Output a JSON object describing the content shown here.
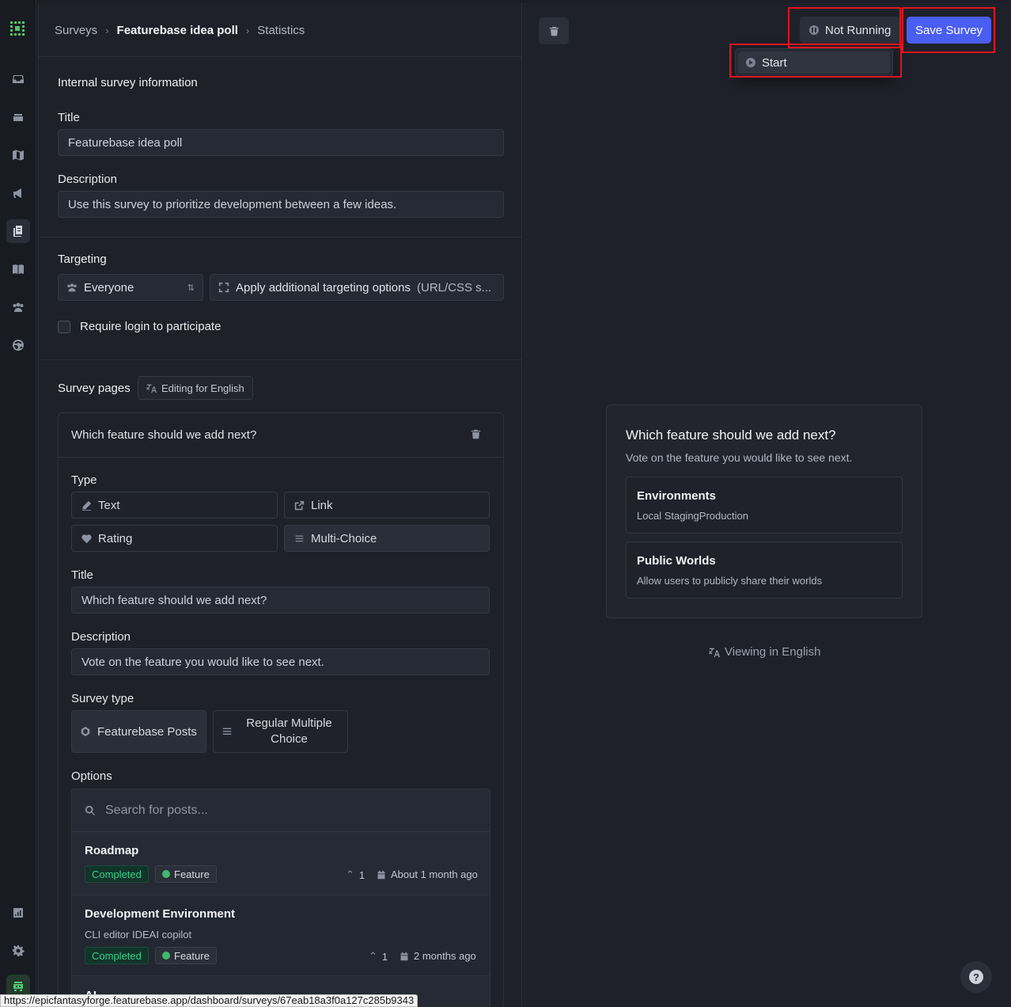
{
  "breadcrumb": {
    "root": "Surveys",
    "current": "Featurebase idea poll",
    "tab": "Statistics"
  },
  "internal": {
    "heading": "Internal survey information",
    "title_label": "Title",
    "title_value": "Featurebase idea poll",
    "description_label": "Description",
    "description_value": "Use this survey to prioritize development between a few ideas."
  },
  "targeting": {
    "heading": "Targeting",
    "audience": "Everyone",
    "additional": "Apply additional targeting options",
    "additional_hint": "(URL/CSS s...",
    "require_login": "Require login to participate"
  },
  "pages": {
    "heading": "Survey pages",
    "language_pill": "Editing for English",
    "page_title": "Which feature should we add next?",
    "type_label": "Type",
    "types": [
      "Text",
      "Link",
      "Rating",
      "Multi-Choice"
    ],
    "selected_type": "Multi-Choice",
    "title_label": "Title",
    "title_value": "Which feature should we add next?",
    "description_label": "Description",
    "description_value": "Vote on the feature you would like to see next.",
    "survey_type_label": "Survey type",
    "survey_types": [
      "Featurebase Posts",
      "Regular Multiple Choice"
    ],
    "selected_survey_type": "Featurebase Posts",
    "options_label": "Options",
    "search_placeholder": "Search for posts...",
    "posts": [
      {
        "title": "Roadmap",
        "description": "",
        "status": "Completed",
        "category": "Feature",
        "upvotes": "1",
        "date": "About 1 month ago"
      },
      {
        "title": "Development Environment",
        "description": "CLI editor IDEAI copilot",
        "status": "Completed",
        "category": "Feature",
        "upvotes": "1",
        "date": "2 months ago"
      },
      {
        "title": "AI",
        "description": "",
        "status": "",
        "category": "",
        "upvotes": "",
        "date": ""
      }
    ]
  },
  "toolbar": {
    "status_button": "Not Running",
    "save_button": "Save Survey",
    "dropdown_item": "Start",
    "highlight_color": "#e0141e",
    "accent_color": "#4a5ef2"
  },
  "preview": {
    "title": "Which feature should we add next?",
    "description": "Vote on the feature you would like to see next.",
    "options": [
      {
        "title": "Environments",
        "description": "Local StagingProduction"
      },
      {
        "title": "Public Worlds",
        "description": "Allow users to publicly share their worlds"
      }
    ],
    "viewing_language": "Viewing in English"
  },
  "help": {
    "label": "?"
  },
  "status_bar_url": "https://epicfantasyforge.featurebase.app/dashboard/surveys/67eab18a3f0a127c285b9343",
  "sidebar_icons": [
    "app-logo-icon",
    "inbox-icon",
    "stack-icon",
    "map-icon",
    "megaphone-icon",
    "surveys-icon",
    "book-icon",
    "users-icon",
    "globe-icon",
    "analytics-icon",
    "settings-icon",
    "user-avatar-icon"
  ]
}
